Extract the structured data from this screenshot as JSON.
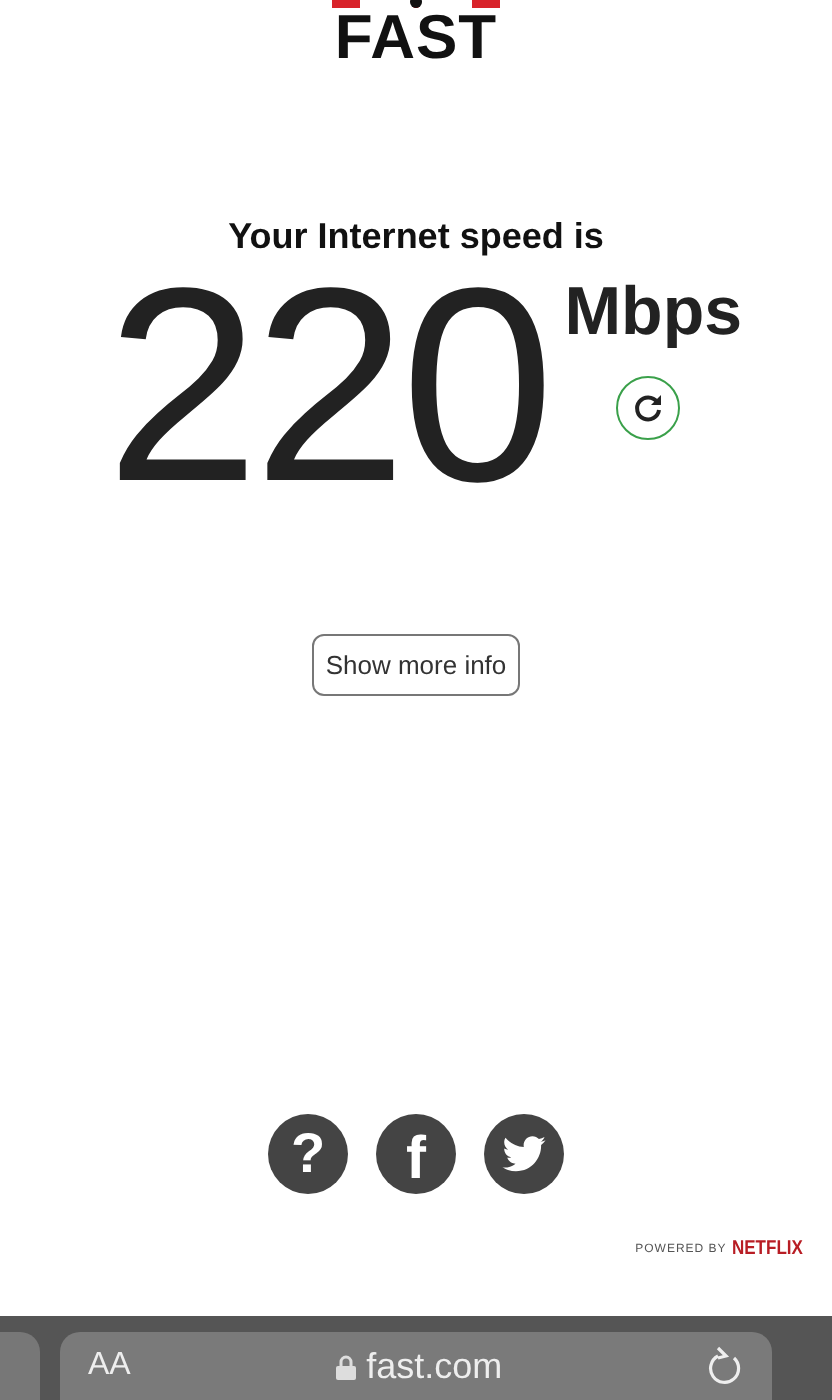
{
  "logo": {
    "text": "FAST"
  },
  "speed": {
    "heading": "Your Internet speed is",
    "value": "220",
    "unit": "Mbps"
  },
  "more_info_button": {
    "label": "Show more info"
  },
  "social": [
    {
      "kind": "help",
      "glyph": "?"
    },
    {
      "kind": "facebook",
      "glyph": "f"
    },
    {
      "kind": "twitter"
    }
  ],
  "footer": {
    "powered_by": "POWERED BY",
    "brand": "NETFLIX"
  },
  "browser_bar": {
    "text_size": "AA",
    "url": "fast.com"
  }
}
